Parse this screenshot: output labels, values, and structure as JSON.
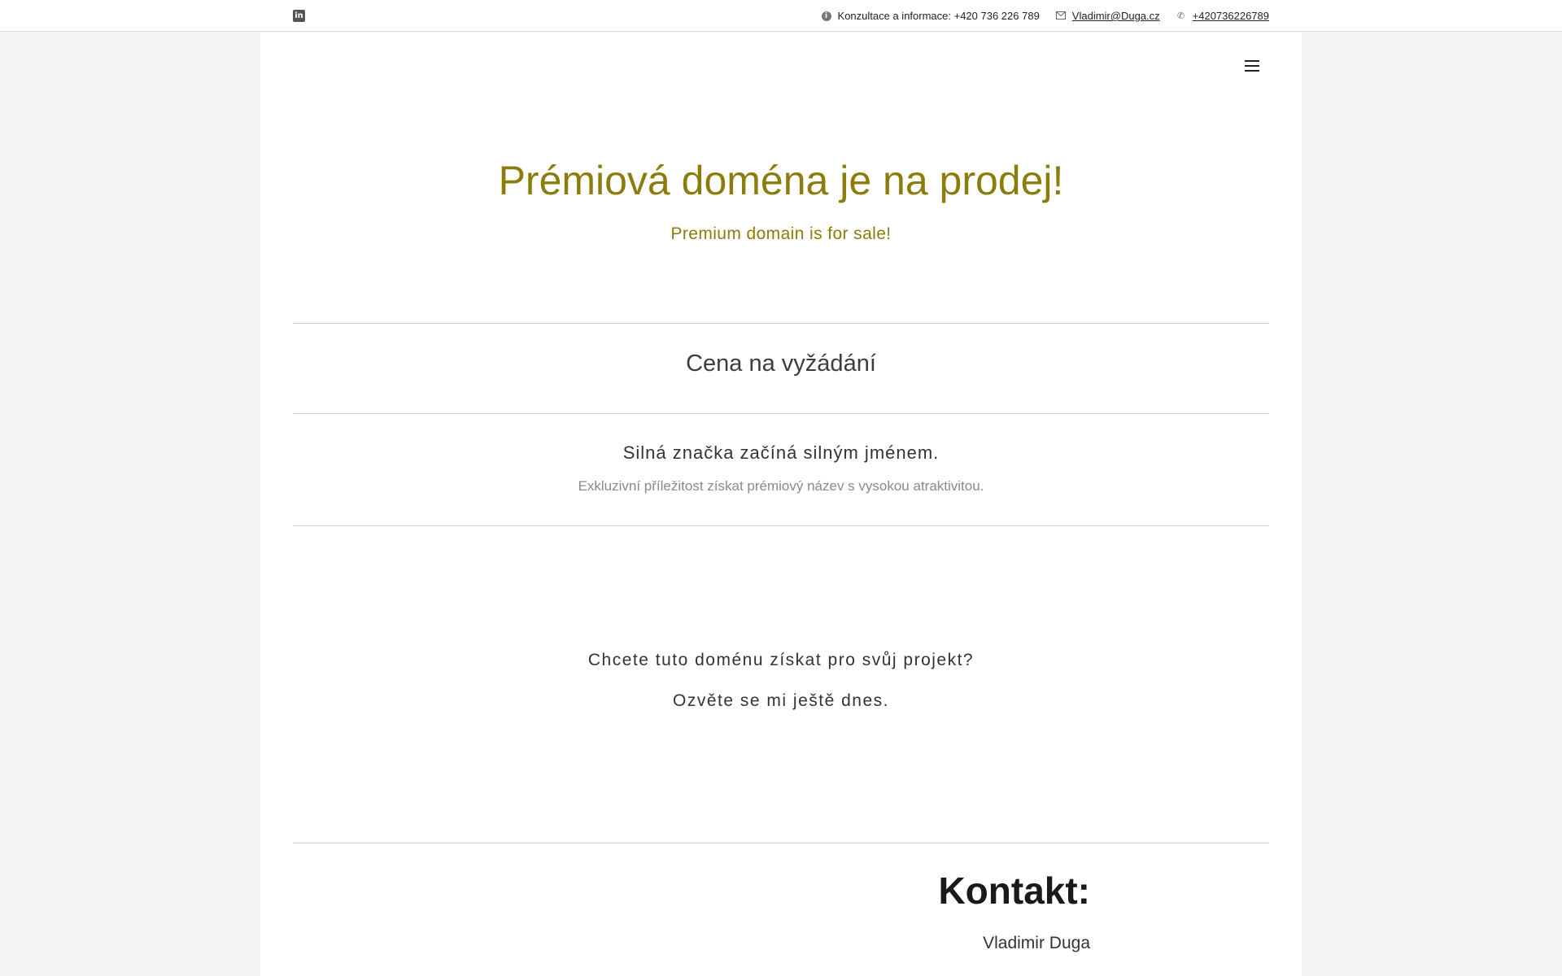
{
  "topbar": {
    "social_icon": "linkedin-icon",
    "info_text": "Konzultace a informace: +420 736 226 789",
    "email": "Vladimir@Duga.cz",
    "phone": "+420736226789"
  },
  "header": {
    "menu_icon": "hamburger-menu-icon"
  },
  "hero": {
    "title": "Prémiová doména je na prodej!",
    "subtitle": "Premium domain is for sale!"
  },
  "price": {
    "text": "Cena na vyžádání"
  },
  "tagline": {
    "title": "Silná značka začíná silným jménem.",
    "description": "Exkluzivní příležitost získat prémiový název s vysokou atraktivitou."
  },
  "cta": {
    "line1": "Chcete tuto doménu získat pro svůj projekt?",
    "line2": "Ozvěte se mi ještě dnes."
  },
  "contact": {
    "title": "Kontakt:",
    "name": "Vladimir Duga"
  },
  "colors": {
    "accent": "#8a7d0c",
    "background": "#f3f2f4",
    "content_bg": "#ffffff"
  }
}
